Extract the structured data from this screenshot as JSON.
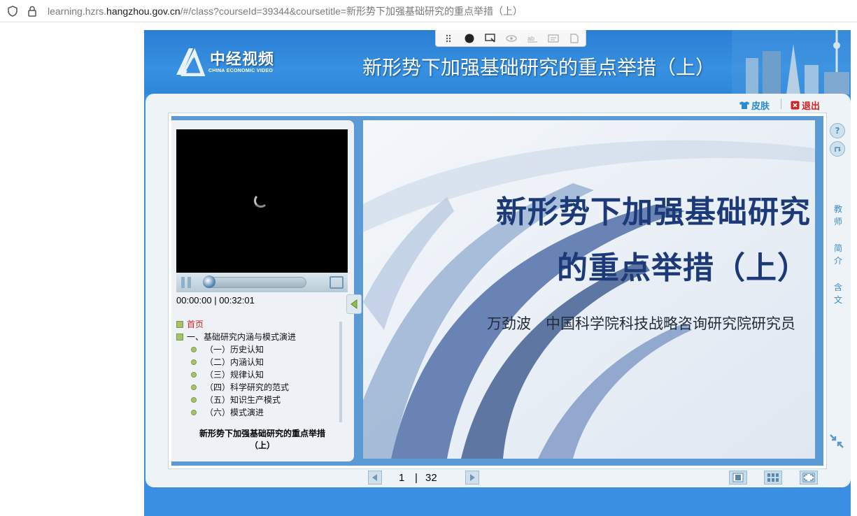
{
  "browser": {
    "url_prefix": "learning.hzrs.",
    "url_host": "hangzhou.gov.cn",
    "url_path": "/#/class?courseId=39344&coursetitle=新形势下加强基础研究的重点举措（上）"
  },
  "header": {
    "logo_cn": "中经视频",
    "logo_en": "CHINA ECONOMIC VIDEO",
    "course_title": "新形势下加强基础研究的重点举措（上）"
  },
  "top_links": {
    "skin": "皮肤",
    "exit": "退出"
  },
  "player": {
    "time_current": "00:00:00",
    "time_separator": "|",
    "time_total": "00:32:01"
  },
  "toc": {
    "home": "首页",
    "chapter1": "一、基础研究内涵与模式演进",
    "items": [
      "（一）历史认知",
      "（二）内涵认知",
      "（三）规律认知",
      "（四）科学研究的范式",
      "（五）知识生产模式",
      "（六）模式演进"
    ]
  },
  "left_title": {
    "line1": "新形势下加强基础研究的重点举措",
    "line2": "（上）"
  },
  "slide": {
    "title_line1": "新形势下加强基础研究",
    "title_line2": "的重点举措（上）",
    "author": "万劲波　中国科学院科技战略咨询研究院研究员"
  },
  "side": {
    "teacher_1": "教",
    "teacher_2": "师",
    "intro_1": "简",
    "intro_2": "介",
    "content_1": "含",
    "content_2": "文"
  },
  "pagination": {
    "current": "1",
    "separator": "|",
    "total": "32"
  },
  "colors": {
    "app_blue": "#3a8fe3",
    "slide_title": "#1d3a78",
    "toc_active": "#d42020",
    "skin_link": "#2a8bd0"
  }
}
